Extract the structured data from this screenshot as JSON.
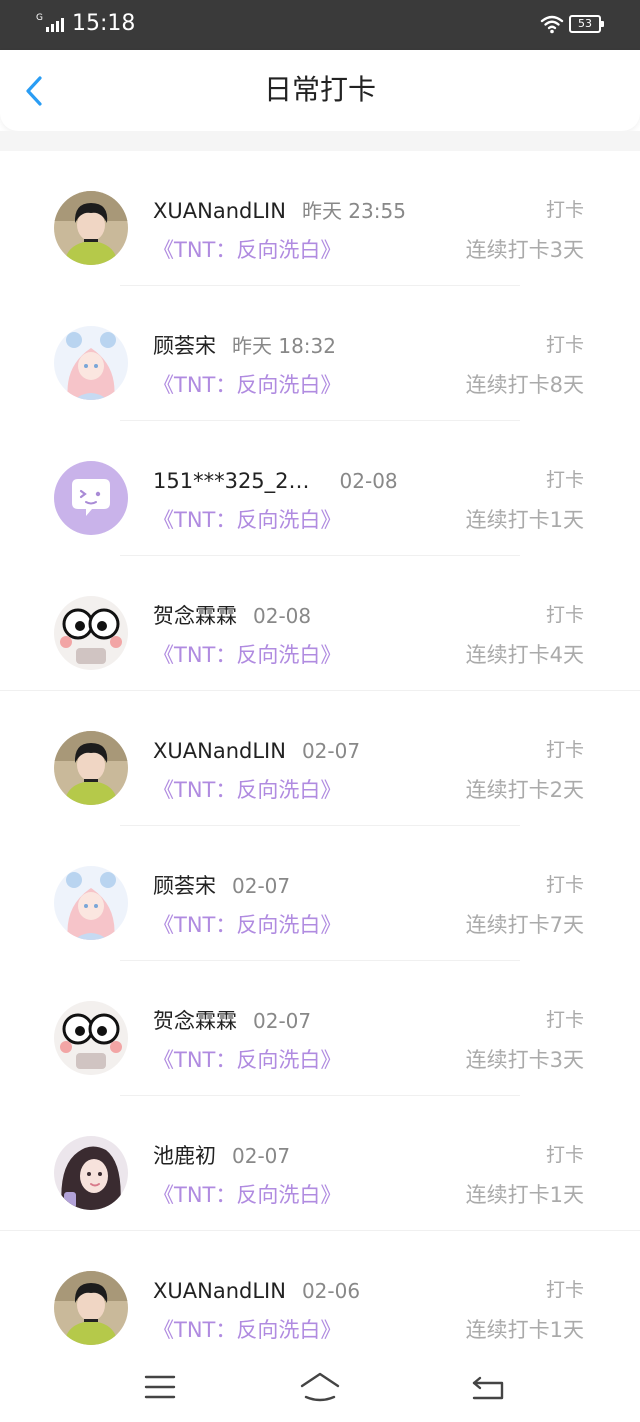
{
  "status_bar": {
    "network": "G",
    "time": "15:18",
    "battery": "53"
  },
  "header": {
    "title": "日常打卡"
  },
  "checkins": [
    {
      "name": "XUANandLIN",
      "time": "昨天 23:55",
      "book": "《TNT：反向洗白》",
      "tag": "打卡",
      "streak": "连续打卡3天",
      "avatar": "photo-avatar-boy"
    },
    {
      "name": "顾荟宋",
      "time": "昨天 18:32",
      "book": "《TNT：反向洗白》",
      "tag": "打卡",
      "streak": "连续打卡8天",
      "avatar": "anime-avatar-girl"
    },
    {
      "name": "151***325_2…",
      "time": "02-08",
      "book": "《TNT：反向洗白》",
      "tag": "打卡",
      "streak": "连续打卡1天",
      "avatar": "default-chat-avatar"
    },
    {
      "name": "贺念霖霖",
      "time": "02-08",
      "book": "《TNT：反向洗白》",
      "tag": "打卡",
      "streak": "连续打卡4天",
      "avatar": "cartoon-face-avatar"
    },
    {
      "name": "XUANandLIN",
      "time": "02-07",
      "book": "《TNT：反向洗白》",
      "tag": "打卡",
      "streak": "连续打卡2天",
      "avatar": "photo-avatar-boy"
    },
    {
      "name": "顾荟宋",
      "time": "02-07",
      "book": "《TNT：反向洗白》",
      "tag": "打卡",
      "streak": "连续打卡7天",
      "avatar": "anime-avatar-girl"
    },
    {
      "name": "贺念霖霖",
      "time": "02-07",
      "book": "《TNT：反向洗白》",
      "tag": "打卡",
      "streak": "连续打卡3天",
      "avatar": "cartoon-face-avatar"
    },
    {
      "name": "池鹿初",
      "time": "02-07",
      "book": "《TNT：反向洗白》",
      "tag": "打卡",
      "streak": "连续打卡1天",
      "avatar": "photo-avatar-girl"
    },
    {
      "name": "XUANandLIN",
      "time": "02-06",
      "book": "《TNT：反向洗白》",
      "tag": "打卡",
      "streak": "连续打卡1天",
      "avatar": "photo-avatar-boy"
    }
  ],
  "icons": {
    "back": "chevron-left-icon",
    "menu": "menu-icon",
    "home": "home-icon",
    "return": "return-icon"
  },
  "colors": {
    "accent": "#2a9df4",
    "book_title": "#b08be0",
    "status_bar": "#3a3a3a"
  }
}
